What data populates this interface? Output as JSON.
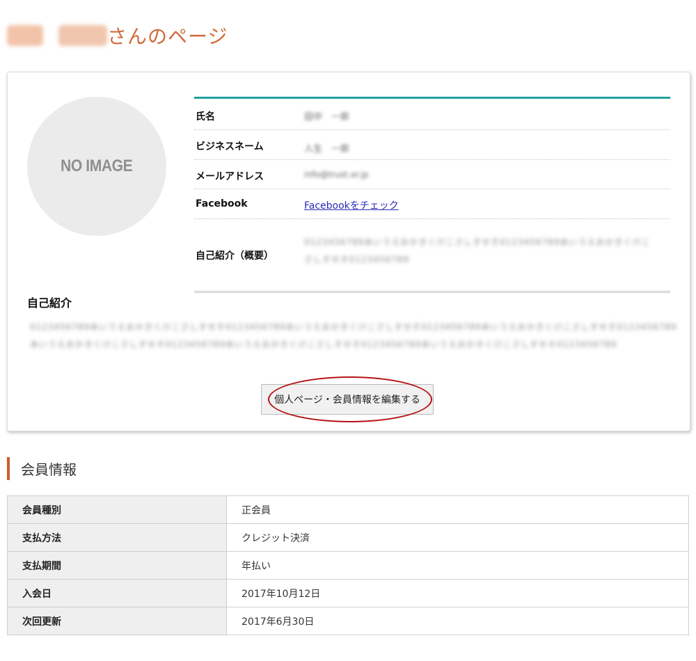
{
  "page": {
    "title_suffix": "さんのページ"
  },
  "profile": {
    "avatar_text": "NO IMAGE",
    "fields": [
      {
        "label": "氏名",
        "value": "田中　一郎"
      },
      {
        "label": "ビジネスネーム",
        "value": "人生　一郎"
      },
      {
        "label": "メールアドレス",
        "value": "info@trust.or.jp"
      },
      {
        "label": "Facebook",
        "value": "Facebookをチェック"
      },
      {
        "label": "自己紹介（概要）",
        "value": "0123456789あいうえおかきくけこさしすせそ0123456789あいうえおかきくけこさしすせそ0123456789"
      }
    ],
    "intro_heading": "自己紹介",
    "intro_text": "0123456789あいうえおかきくけこさしすせそ0123456789あいうえおかきくけこさしすせそ0123456789あいうえおかきくけこさしすせそ0123456789あいうえおかきくけこさしすせそ0123456789あいうえおかきくけこさしすせそ0123456789あいうえおかきくけこさしすせそ0123456789",
    "edit_button": "個人ページ・会員情報を編集する"
  },
  "member_info": {
    "heading": "会員情報",
    "rows": [
      {
        "label": "会員種別",
        "value": "正会員"
      },
      {
        "label": "支払方法",
        "value": "クレジット決済"
      },
      {
        "label": "支払期間",
        "value": "年払い"
      },
      {
        "label": "入会日",
        "value": "2017年10月12日"
      },
      {
        "label": "次回更新",
        "value": "2017年6月30日"
      }
    ]
  },
  "colors": {
    "title": "#d16a3a",
    "accent_teal": "#1ea2a0",
    "section_bar": "#d05a2a",
    "highlight": "#b51414",
    "link": "#2a2ab8"
  }
}
